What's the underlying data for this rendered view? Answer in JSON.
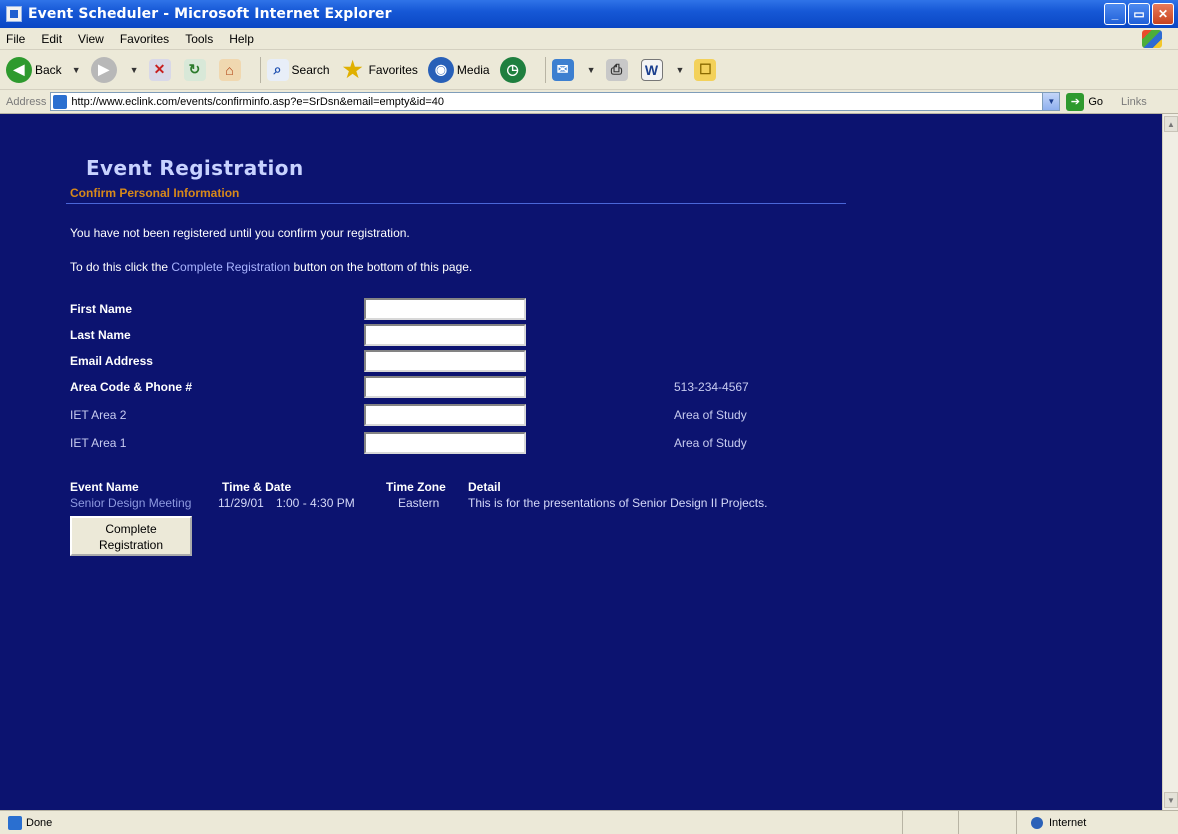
{
  "window": {
    "title": "Event Scheduler - Microsoft Internet Explorer",
    "minimize": "_",
    "maximize": "▭",
    "close": "✕"
  },
  "menu": [
    "File",
    "Edit",
    "View",
    "Favorites",
    "Tools",
    "Help"
  ],
  "toolbar": {
    "back_label": "Back",
    "search_label": "Search",
    "favorites_label": "Favorites",
    "media_label": "Media"
  },
  "address": {
    "label": "Address",
    "url": "http://www.eclink.com/events/confirminfo.asp?e=SrDsn&email=empty&id=40",
    "go_label": "Go",
    "links_label": "Links"
  },
  "page": {
    "heading": "Event Registration",
    "subheading": "Confirm Personal Information",
    "notice1": "You have not been registered until you confirm your registration.",
    "notice2_prefix": "To do this click the ",
    "notice2_link": "Complete Registration",
    "notice2_suffix": " button on the bottom of this page.",
    "fields": [
      {
        "label": "First Name",
        "value": "",
        "hint": ""
      },
      {
        "label": "Last Name",
        "value": "",
        "hint": ""
      },
      {
        "label": "Email Address",
        "value": "",
        "hint": ""
      },
      {
        "label": "Area Code & Phone #",
        "value": "",
        "hint": "513-234-4567"
      },
      {
        "label": "IET Area 2",
        "value": "",
        "hint": "Area of Study"
      },
      {
        "label": "IET Area 1",
        "value": "",
        "hint": "Area of Study"
      }
    ],
    "event": {
      "headers": {
        "name": "Event Name",
        "time_date": "Time & Date",
        "time_zone": "Time Zone",
        "detail": "Detail"
      },
      "name": "Senior Design Meeting",
      "date": "11/29/01",
      "time": "1:00 - 4:30 PM",
      "time_zone": "Eastern",
      "detail": "This is for the presentations of Senior Design II Projects."
    },
    "button_line1": "Complete",
    "button_line2": "Registration"
  },
  "status": {
    "text": "Done",
    "zone": "Internet"
  },
  "colors": {
    "page_background": "#0c1370",
    "subheading": "#d8891a",
    "link": "#a9b4ff"
  }
}
